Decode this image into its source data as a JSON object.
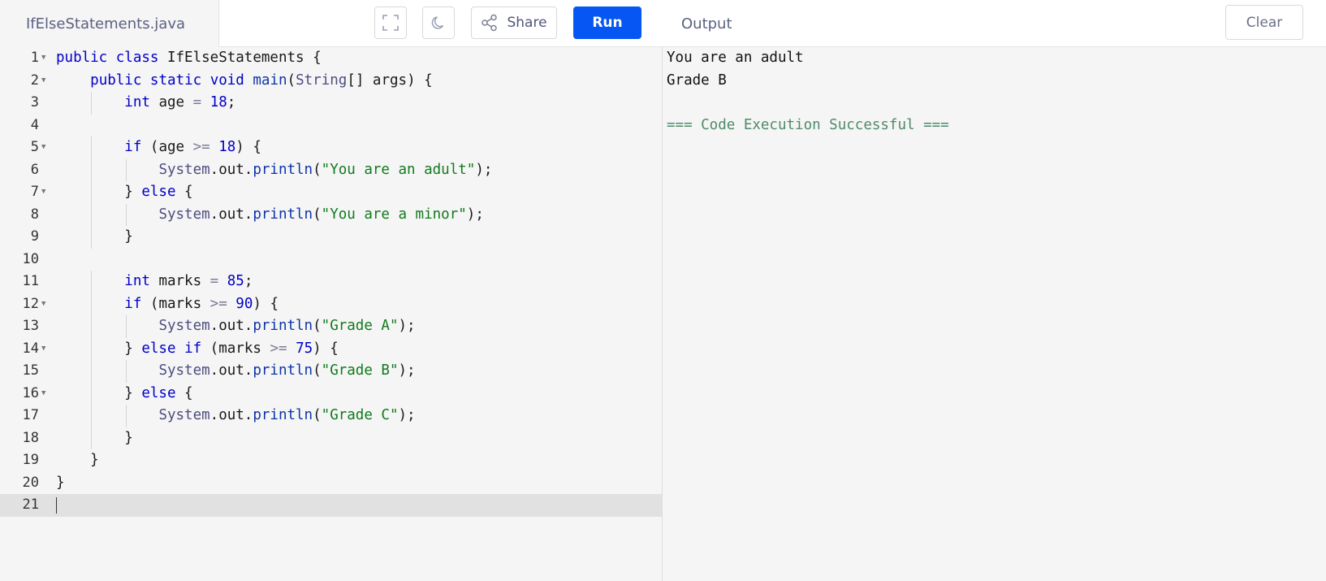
{
  "editor": {
    "file_name": "IfElseStatements.java",
    "share_label": "Share",
    "run_label": "Run",
    "lines": [
      {
        "n": "1",
        "fold": true,
        "text": "public class IfElseStatements {"
      },
      {
        "n": "2",
        "fold": true,
        "text": "    public static void main(String[] args) {"
      },
      {
        "n": "3",
        "fold": false,
        "text": "        int age = 18;"
      },
      {
        "n": "4",
        "fold": false,
        "text": ""
      },
      {
        "n": "5",
        "fold": true,
        "text": "        if (age >= 18) {"
      },
      {
        "n": "6",
        "fold": false,
        "text": "            System.out.println(\"You are an adult\");"
      },
      {
        "n": "7",
        "fold": true,
        "text": "        } else {"
      },
      {
        "n": "8",
        "fold": false,
        "text": "            System.out.println(\"You are a minor\");"
      },
      {
        "n": "9",
        "fold": false,
        "text": "        }"
      },
      {
        "n": "10",
        "fold": false,
        "text": ""
      },
      {
        "n": "11",
        "fold": false,
        "text": "        int marks = 85;"
      },
      {
        "n": "12",
        "fold": true,
        "text": "        if (marks >= 90) {"
      },
      {
        "n": "13",
        "fold": false,
        "text": "            System.out.println(\"Grade A\");"
      },
      {
        "n": "14",
        "fold": true,
        "text": "        } else if (marks >= 75) {"
      },
      {
        "n": "15",
        "fold": false,
        "text": "            System.out.println(\"Grade B\");"
      },
      {
        "n": "16",
        "fold": true,
        "text": "        } else {"
      },
      {
        "n": "17",
        "fold": false,
        "text": "            System.out.println(\"Grade C\");"
      },
      {
        "n": "18",
        "fold": false,
        "text": "        }"
      },
      {
        "n": "19",
        "fold": false,
        "text": "    }"
      },
      {
        "n": "20",
        "fold": false,
        "text": "}"
      },
      {
        "n": "21",
        "fold": false,
        "text": ""
      }
    ],
    "active_line": "21"
  },
  "output": {
    "title": "Output",
    "clear_label": "Clear",
    "lines": [
      {
        "text": "You are an adult",
        "kind": "stdout"
      },
      {
        "text": "Grade B",
        "kind": "stdout"
      },
      {
        "text": "",
        "kind": "stdout"
      },
      {
        "text": "=== Code Execution Successful ===",
        "kind": "success"
      }
    ]
  },
  "colors": {
    "run_button": "#0556f3",
    "keyword": "#0000c8",
    "string": "#117a1d",
    "success": "#4f8a69",
    "active_line": "#e1e1e1"
  },
  "icons": {
    "fullscreen": "fullscreen-icon",
    "theme": "moon-icon",
    "share": "share-icon"
  }
}
